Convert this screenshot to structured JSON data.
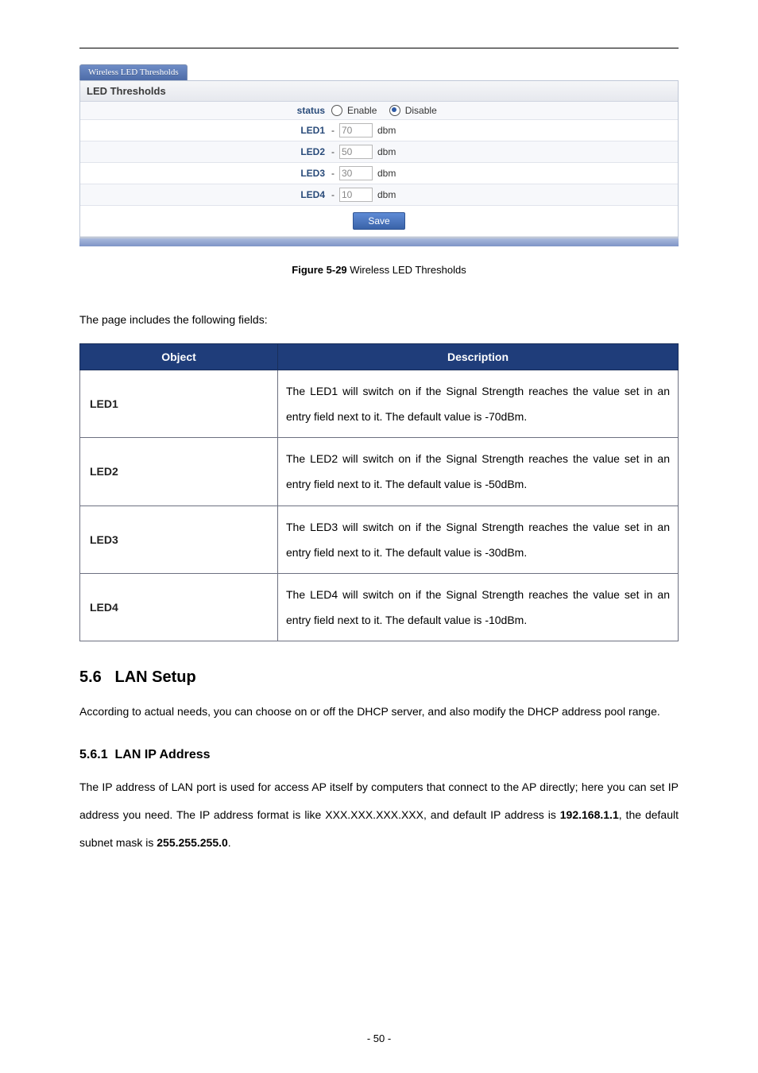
{
  "panel": {
    "tab_title": "Wireless LED Thresholds",
    "sub_header": "LED Thresholds",
    "status_label": "status",
    "enable_label": "Enable",
    "disable_label": "Disable",
    "status_selected": "disable",
    "leds": [
      {
        "label": "LED1",
        "value": "70",
        "unit": "dbm"
      },
      {
        "label": "LED2",
        "value": "50",
        "unit": "dbm"
      },
      {
        "label": "LED3",
        "value": "30",
        "unit": "dbm"
      },
      {
        "label": "LED4",
        "value": "10",
        "unit": "dbm"
      }
    ],
    "save_label": "Save"
  },
  "figure": {
    "label_bold": "Figure 5-29",
    "label_rest": " Wireless LED Thresholds"
  },
  "fields_intro": "The page includes the following fields:",
  "table": {
    "headers": {
      "object": "Object",
      "description": "Description"
    },
    "rows": [
      {
        "object": "LED1",
        "description": "The LED1 will switch on if the Signal Strength reaches the value set in an entry field next to it. The default value is -70dBm."
      },
      {
        "object": "LED2",
        "description": "The LED2 will switch on if the Signal Strength reaches the value set in an entry field next to it. The default value is -50dBm."
      },
      {
        "object": "LED3",
        "description": "The LED3 will switch on if the Signal Strength reaches the value set in an entry field next to it. The default value is -30dBm."
      },
      {
        "object": "LED4",
        "description": "The LED4 will switch on if the Signal Strength reaches the value set in an entry field next to it. The default value is -10dBm."
      }
    ]
  },
  "section": {
    "number": "5.6",
    "title": "LAN Setup",
    "para": "According to actual needs, you can choose on or off the DHCP server, and also modify the DHCP address pool range."
  },
  "subsection": {
    "number": "5.6.1",
    "title": "LAN IP Address",
    "para_pre": "The IP address of LAN port is used for access AP itself by computers that connect to the AP directly; here you can set IP address you need. The IP address format is like XXX.XXX.XXX.XXX, and default IP address is ",
    "ip": "192.168.1.1",
    "para_mid": ", the default subnet mask is ",
    "mask": "255.255.255.0",
    "para_post": "."
  },
  "page_number": "- 50 -"
}
